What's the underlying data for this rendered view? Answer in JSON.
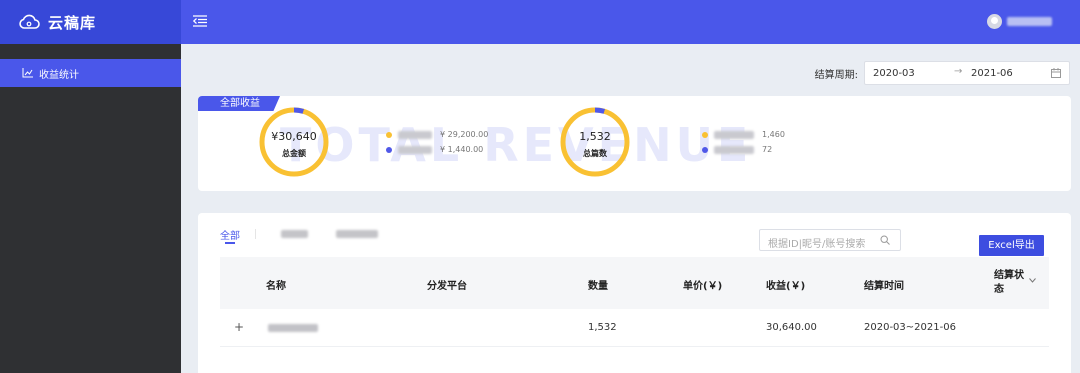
{
  "app": {
    "name": "云稿库",
    "brand_color": "#3748d8",
    "accent": "#4a57ea"
  },
  "sidebar": {
    "items": [
      {
        "label": "收益统计",
        "icon": "chart-icon",
        "active": true
      }
    ]
  },
  "topbar": {
    "menu_icon": "menu-fold-icon",
    "avatar_icon": "user-avatar"
  },
  "filter": {
    "label": "结算周期:",
    "start": "2020-03",
    "separator": "→",
    "end": "2021-06",
    "icon": "calendar-icon"
  },
  "summary": {
    "tag": "全部收益",
    "watermark": "TOTAL REVENUE",
    "amount": {
      "value": "¥30,640",
      "label": "总金额",
      "fraction_primary": 0.953,
      "legend": [
        {
          "color": "#f9c133",
          "value": "¥ 29,200.00"
        },
        {
          "color": "#5058e8",
          "value": "¥ 1,440.00"
        }
      ]
    },
    "articles": {
      "value": "1,532",
      "label": "总篇数",
      "fraction_primary": 0.953,
      "legend": [
        {
          "color": "#f9c133",
          "value": "1,460"
        },
        {
          "color": "#5058e8",
          "value": "72"
        }
      ]
    }
  },
  "table": {
    "tabs": [
      {
        "label": "全部",
        "active": true
      }
    ],
    "search_placeholder": "根据ID|昵号/账号搜索",
    "search_icon": "search-icon",
    "export_label": "Excel导出",
    "columns": {
      "name": "名称",
      "platform": "分发平台",
      "quantity": "数量",
      "unit_price": "单价(￥)",
      "revenue": "收益(￥)",
      "period": "结算时间",
      "status": "结算状态"
    },
    "rows": [
      {
        "expand": "+",
        "platform": "",
        "quantity": "1,532",
        "unit_price": "",
        "revenue": "30,640.00",
        "period": "2020-03~2021-06",
        "status": ""
      }
    ]
  }
}
